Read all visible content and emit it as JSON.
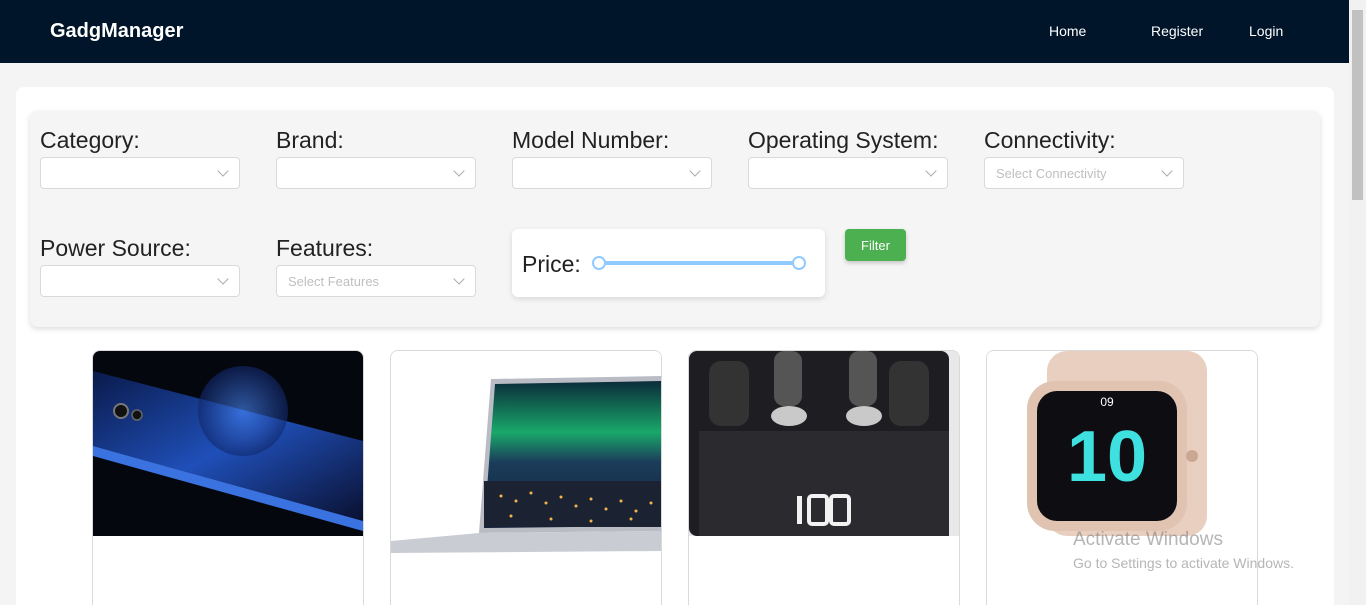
{
  "app": {
    "brand": "GadgManager"
  },
  "nav": {
    "home": "Home",
    "register": "Register",
    "login": "Login"
  },
  "filters": {
    "category": {
      "label": "Category:",
      "placeholder": ""
    },
    "brand": {
      "label": "Brand:",
      "placeholder": ""
    },
    "model_number": {
      "label": "Model Number:",
      "placeholder": ""
    },
    "operating_system": {
      "label": "Operating System:",
      "placeholder": ""
    },
    "connectivity": {
      "label": "Connectivity:",
      "placeholder": "Select Connectivity"
    },
    "power_source": {
      "label": "Power Source:",
      "placeholder": ""
    },
    "features": {
      "label": "Features:",
      "placeholder": "Select Features"
    },
    "price": {
      "label": "Price:",
      "range_fraction": [
        0,
        1
      ]
    },
    "filter_button": "Filter"
  },
  "products": [
    {
      "image": "phone-image",
      "title": ""
    },
    {
      "image": "laptop-image",
      "title": ""
    },
    {
      "image": "earbuds-image",
      "title": ""
    },
    {
      "image": "smartwatch-image",
      "title": ""
    }
  ],
  "watermark": {
    "line1": "Activate Windows",
    "line2": "Go to Settings to activate Windows."
  },
  "colors": {
    "navbar": "#001529",
    "filter_button": "#4caf50",
    "slider": "#91caff"
  }
}
